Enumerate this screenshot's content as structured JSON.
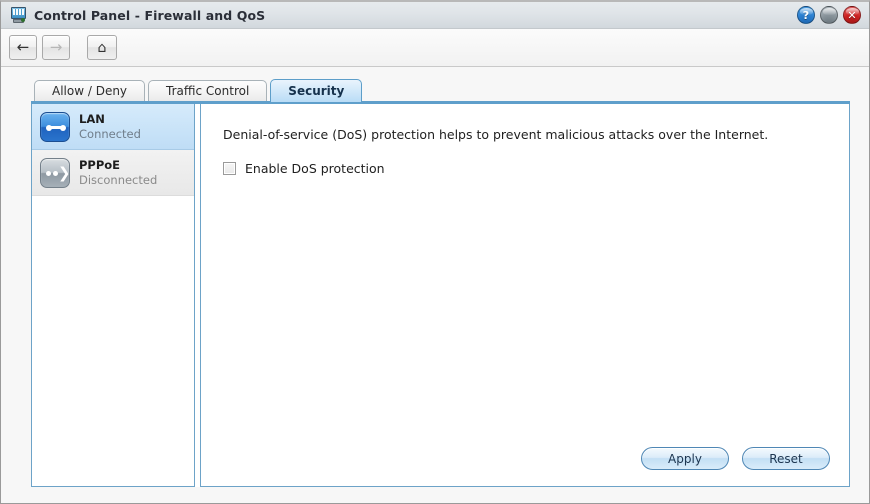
{
  "window": {
    "title": "Control Panel - Firewall and QoS",
    "icon": "computer-monitor-icon",
    "controls": {
      "help_label": "?",
      "minimize_label": "",
      "close_label": "✕"
    }
  },
  "toolbar": {
    "back_label": "←",
    "forward_label": "→",
    "home_label": "⌂"
  },
  "tabs": [
    {
      "label": "Allow / Deny",
      "active": false
    },
    {
      "label": "Traffic Control",
      "active": false
    },
    {
      "label": "Security",
      "active": true
    }
  ],
  "sidebar": {
    "items": [
      {
        "name": "LAN",
        "status": "Connected",
        "icon": "lan-network-icon",
        "selected": true
      },
      {
        "name": "PPPoE",
        "status": "Disconnected",
        "icon": "pppoe-arrow-icon",
        "selected": false
      }
    ]
  },
  "content": {
    "description": "Denial-of-service (DoS) protection helps to prevent malicious attacks over the Internet.",
    "checkbox_label": "Enable DoS protection",
    "checkbox_checked": false
  },
  "actions": {
    "apply_label": "Apply",
    "reset_label": "Reset"
  },
  "colors": {
    "accent_blue": "#5f9fcb",
    "tab_active": "#b9dcf6",
    "selected_row": "#bfddf6",
    "close_red": "#cc2222",
    "help_blue": "#2b7fd0"
  }
}
